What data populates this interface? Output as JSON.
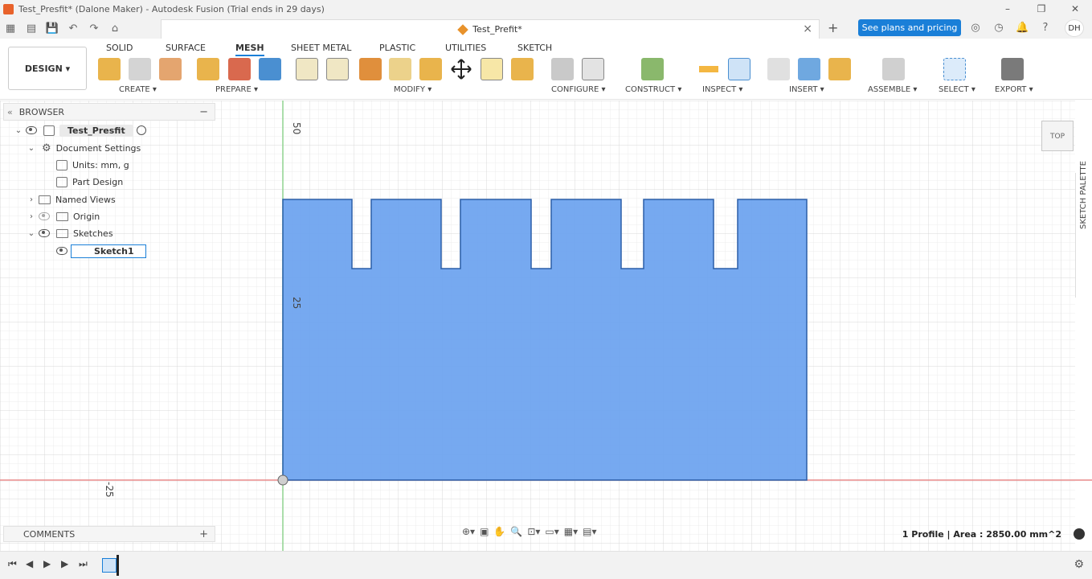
{
  "titlebar": {
    "title": "Test_Presfit* (Dalone Maker) - Autodesk Fusion (Trial ends in 29 days)"
  },
  "tabbar": {
    "doc_title": "Test_Prefit*",
    "plans_label": "See plans and pricing",
    "avatar": "DH"
  },
  "ribbon": {
    "design_label": "DESIGN ▾",
    "tabs": [
      "SOLID",
      "SURFACE",
      "MESH",
      "SHEET METAL",
      "PLASTIC",
      "UTILITIES",
      "SKETCH"
    ],
    "active_tab": "MESH",
    "groups": [
      "CREATE ▾",
      "PREPARE ▾",
      "MODIFY ▾",
      "CONFIGURE ▾",
      "CONSTRUCT ▾",
      "INSPECT ▾",
      "INSERT ▾",
      "ASSEMBLE ▾",
      "SELECT ▾",
      "EXPORT ▾"
    ]
  },
  "browser": {
    "label": "BROWSER",
    "root": "Test_Presfit",
    "document_settings": "Document Settings",
    "units": "Units: mm, g",
    "part_design": "Part Design",
    "named_views": "Named Views",
    "origin": "Origin",
    "sketches": "Sketches",
    "sketch1": "Sketch1"
  },
  "canvas": {
    "ruler_labels": [
      "50",
      "25",
      "-25"
    ],
    "view_cube": "TOP",
    "sketch_palette": "SKETCH PALETTE",
    "profile_area": "1 Profile | Area : 2850.00 mm^2",
    "profile_color": "#6fa4ef"
  },
  "comments": {
    "label": "COMMENTS"
  },
  "colors": {
    "accent": "#1a7fd8",
    "axis_red": "#e06666",
    "axis_green": "#66cc66"
  }
}
